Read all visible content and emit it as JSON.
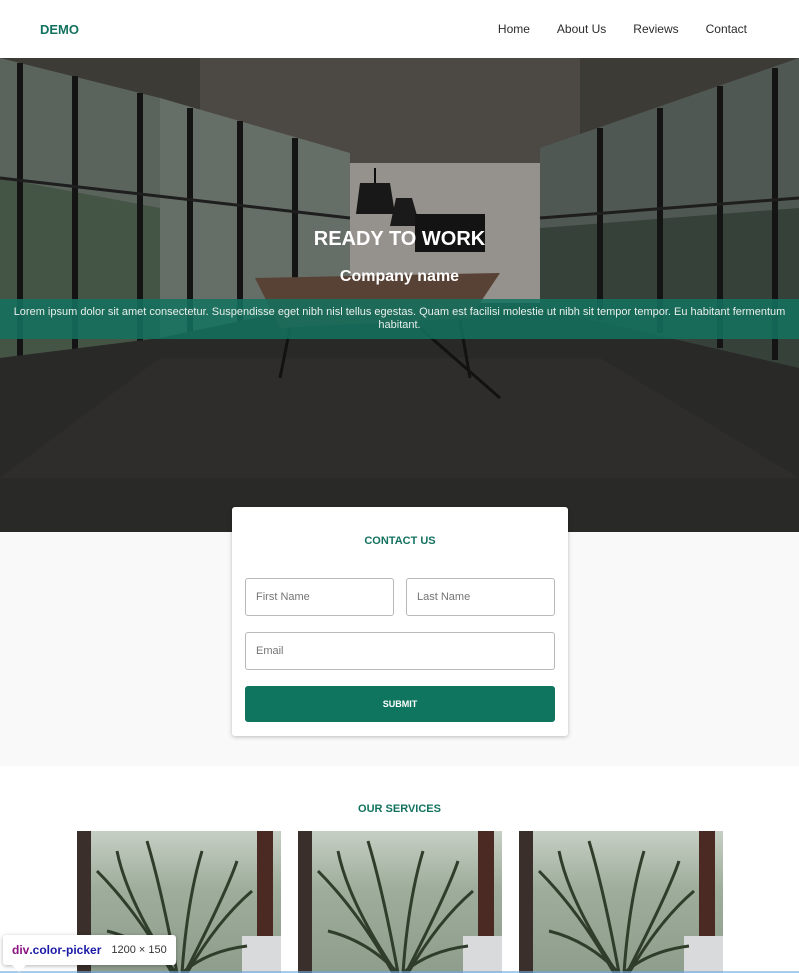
{
  "navbar": {
    "logo": "DEMO",
    "links": [
      "Home",
      "About Us",
      "Reviews",
      "Contact"
    ]
  },
  "hero": {
    "title": "READY TO WORK",
    "subtitle": "Company name",
    "description": "Lorem ipsum dolor sit amet consectetur. Suspendisse eget nibh nisl tellus egestas. Quam est facilisi molestie ut nibh sit tempor tempor. Eu habitant fermentum habitant."
  },
  "contact": {
    "title": "CONTACT US",
    "first_name_placeholder": "First Name",
    "last_name_placeholder": "Last Name",
    "email_placeholder": "Email",
    "submit_label": "SUBMIT"
  },
  "services": {
    "title": "OUR SERVICES",
    "items": [
      {
        "image": "plant-photo"
      },
      {
        "image": "plant-photo"
      },
      {
        "image": "plant-photo"
      }
    ]
  },
  "inspector": {
    "tag": "div",
    "class": ".color-picker",
    "dimensions": "1200 × 150"
  },
  "colors": {
    "brand": "#13725f",
    "button": "#10755f",
    "band": "rgba(19,114,95,0.85)"
  }
}
